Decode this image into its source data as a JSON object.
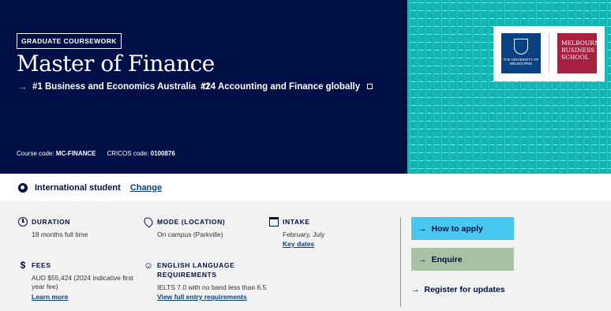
{
  "hero": {
    "badge": "GRADUATE COURSEWORK",
    "title": "Master of Finance",
    "rankings": [
      {
        "label": "#1 Business and Economics Australia"
      },
      {
        "label": "#24 Accounting and Finance globally"
      }
    ],
    "course_code_label": "Course code:",
    "course_code": "MC-FINANCE",
    "cricos_label": "CRICOS code:",
    "cricos_code": "0100876",
    "logos": {
      "uom_text": "THE UNIVERSITY OF MELBOURNE",
      "mbs_line1": "MELBOURNE",
      "mbs_line2": "BUSINESS",
      "mbs_line3": "SCHOOL"
    }
  },
  "student": {
    "label": "International student",
    "change": "Change"
  },
  "details": {
    "duration": {
      "heading": "DURATION",
      "value": "18 months full time"
    },
    "mode": {
      "heading": "MODE (LOCATION)",
      "value": "On campus (Parkville)"
    },
    "intake": {
      "heading": "INTAKE",
      "value": "February, July",
      "link": "Key dates"
    },
    "fees": {
      "heading": "FEES",
      "value_line1": "AUD $55,424 (2024 indicative first",
      "value_line2": "year fee)",
      "link": "Learn more"
    },
    "english": {
      "heading_line1": "ENGLISH LANGUAGE",
      "heading_line2": "REQUIREMENTS",
      "value": "IELTS 7.0 with no band less than 6.5",
      "link": "View full entry requirements"
    }
  },
  "actions": {
    "apply": "How to apply",
    "enquire": "Enquire",
    "register": "Register for updates"
  },
  "colors": {
    "navy": "#000f46",
    "teal_pattern": "#14b3b4",
    "apply_button": "#46c8f0",
    "enquire_button": "#a9c2a4",
    "uom_blue": "#094183",
    "mbs_red": "#a5213f"
  }
}
